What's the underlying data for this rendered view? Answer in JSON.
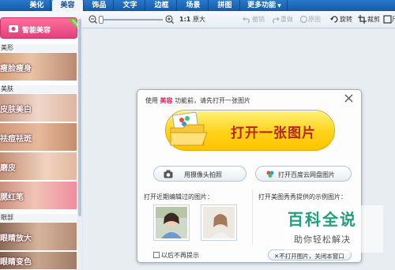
{
  "tabs": [
    {
      "label": "美化",
      "active": false
    },
    {
      "label": "美容",
      "active": true
    },
    {
      "label": "饰品",
      "active": false
    },
    {
      "label": "文字",
      "active": false
    },
    {
      "label": "边框",
      "active": false
    },
    {
      "label": "场景",
      "active": false
    },
    {
      "label": "拼图",
      "active": false
    },
    {
      "label": "更多功能",
      "active": false
    }
  ],
  "toolbar": {
    "zoom_ratio": "1:1",
    "original_size": "原大",
    "undo": "撤销",
    "redo": "重做",
    "original_image": "原图",
    "rotate": "旋转",
    "crop": "裁剪",
    "size": "尺"
  },
  "sidebar": {
    "smart_beauty": "智能美容",
    "new_badge": "new",
    "sections": [
      {
        "title": "美形",
        "items": [
          "瘦脸瘦身"
        ]
      },
      {
        "title": "美肤",
        "items": [
          "皮肤美白",
          "祛痘祛斑",
          "磨皮",
          "腮红笔"
        ]
      },
      {
        "title": "眼部",
        "items": [
          "眼睛放大",
          "眼睛变色"
        ]
      }
    ]
  },
  "dialog": {
    "title_prefix": "使用",
    "title_highlight": "美容",
    "title_suffix": "功能前，请先打开一张图片",
    "open_button": "打开一张图片",
    "camera_button": "用摄像头拍照",
    "cloud_button": "打开百度云网盘图片",
    "recent_label": "打开近期编辑过的图片：",
    "sample_label": "打开美图秀秀提供的示例图片：",
    "dont_show_again": "以后不再提示",
    "dont_open_button": "不打开图片，关闭本窗口"
  },
  "watermark": {
    "title": "百科全说",
    "subtitle": "助你轻松解决"
  }
}
